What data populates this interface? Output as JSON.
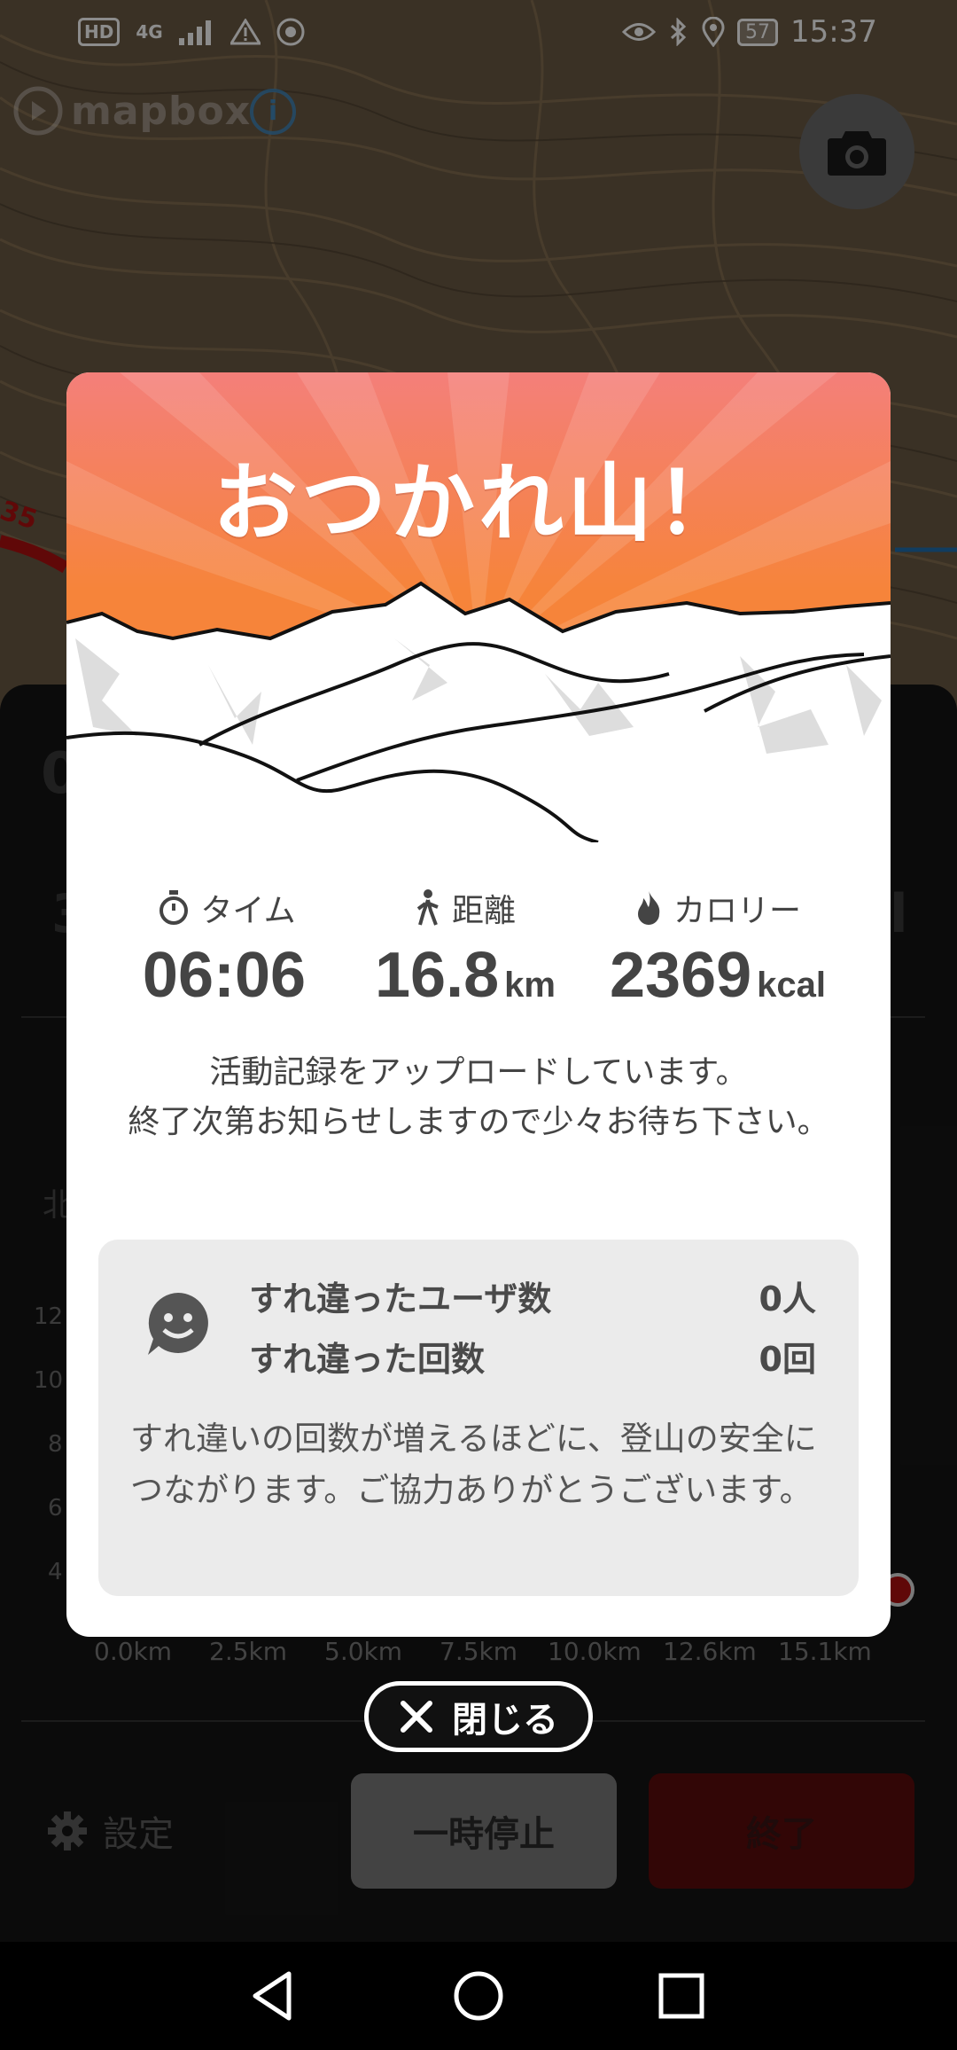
{
  "status_bar": {
    "hd": "HD",
    "network": "4G",
    "battery": "57",
    "time": "15:37"
  },
  "map": {
    "logo_text": "mapbox",
    "info_icon_glyph": "i",
    "route_marker_label": "35"
  },
  "modal": {
    "headline": "おつかれ山！",
    "stats": [
      {
        "label": "タイム",
        "value": "06:06",
        "unit": "",
        "icon": "stopwatch-icon"
      },
      {
        "label": "距離",
        "value": "16.8",
        "unit": "km",
        "icon": "hiker-icon"
      },
      {
        "label": "カロリー",
        "value": "2369",
        "unit": "kcal",
        "icon": "flame-icon"
      }
    ],
    "upload_message": "活動記録をアップロードしています。\n終了次第お知らせしますので少々お待ち下さい。",
    "encounter": {
      "users_label": "すれ違ったユーザ数",
      "users_value": "0人",
      "count_label": "すれ違った回数",
      "count_value": "0回",
      "note": "すれ違いの回数が増えるほどに、登山の安全につながります。ご協力ありがとうございます。"
    }
  },
  "close_button": {
    "label": "閉じる"
  },
  "chart": {
    "x_ticks": [
      "0.0km",
      "2.5km",
      "5.0km",
      "7.5km",
      "10.0km",
      "12.6km",
      "15.1km"
    ],
    "y_ticks": [
      "12",
      "10",
      "8",
      "6",
      "4"
    ]
  },
  "panel": {
    "partial_left_1": "0",
    "partial_left_2": "3",
    "partial_right": "l",
    "partial_north": "北"
  },
  "actions": {
    "settings_label": "設定",
    "pause_label": "一時停止",
    "end_label": "終了"
  },
  "colors": {
    "header_top": "#f47f7a",
    "header_bottom": "#f6843a",
    "end_button": "#5c0b0b",
    "modal_text": "#444444"
  }
}
